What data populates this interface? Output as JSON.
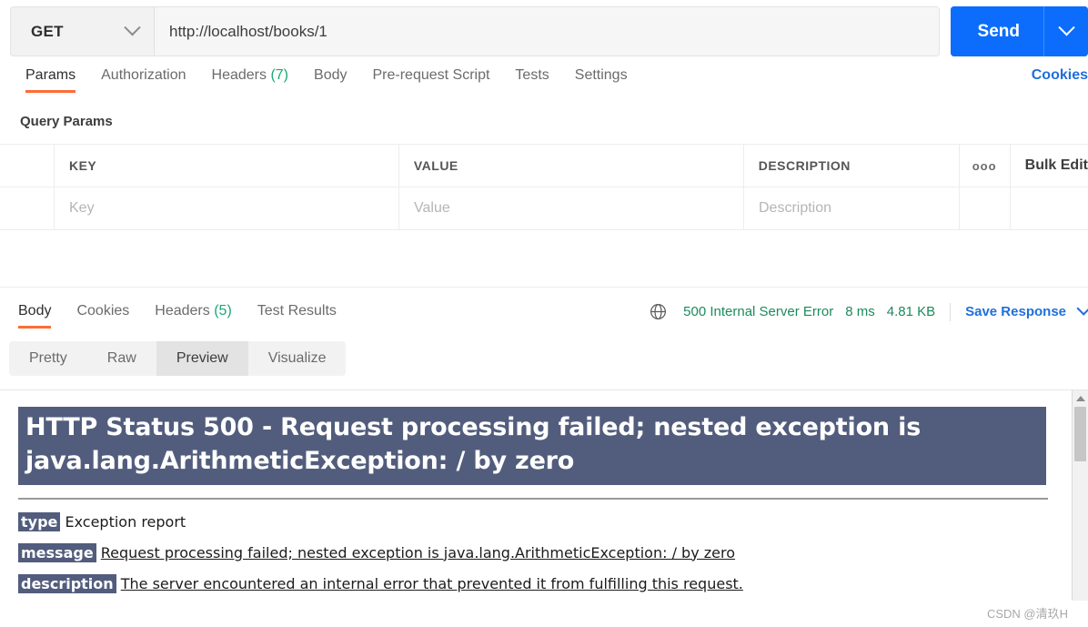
{
  "request": {
    "method": "GET",
    "url": "http://localhost/books/1",
    "send_label": "Send",
    "method_caret_icon": "chevron-down-icon",
    "send_caret_icon": "chevron-down-icon",
    "tabs": [
      {
        "label": "Params",
        "active": true,
        "count": null
      },
      {
        "label": "Authorization",
        "active": false,
        "count": null
      },
      {
        "label": "Headers",
        "active": false,
        "count": "(7)"
      },
      {
        "label": "Body",
        "active": false,
        "count": null
      },
      {
        "label": "Pre-request Script",
        "active": false,
        "count": null
      },
      {
        "label": "Tests",
        "active": false,
        "count": null
      },
      {
        "label": "Settings",
        "active": false,
        "count": null
      }
    ],
    "cookies_link": "Cookies"
  },
  "query_params": {
    "section_title": "Query Params",
    "headers": {
      "key": "KEY",
      "value": "VALUE",
      "description": "DESCRIPTION"
    },
    "options_icon": "ooo",
    "bulk_edit_label": "Bulk Edit",
    "placeholders": {
      "key": "Key",
      "value": "Value",
      "description": "Description"
    }
  },
  "response": {
    "tabs": [
      {
        "label": "Body",
        "active": true,
        "count": null
      },
      {
        "label": "Cookies",
        "active": false,
        "count": null
      },
      {
        "label": "Headers",
        "active": false,
        "count": "(5)"
      },
      {
        "label": "Test Results",
        "active": false,
        "count": null
      }
    ],
    "globe_icon": "globe-icon",
    "status": "500 Internal Server Error",
    "time": "8 ms",
    "size": "4.81 KB",
    "save_response_label": "Save Response",
    "save_caret_icon": "chevron-down-icon",
    "view_modes": [
      {
        "label": "Pretty",
        "active": false
      },
      {
        "label": "Raw",
        "active": false
      },
      {
        "label": "Preview",
        "active": true
      },
      {
        "label": "Visualize",
        "active": false
      }
    ]
  },
  "preview": {
    "banner": "HTTP Status 500 - Request processing failed; nested exception is java.lang.ArithmeticException: / by zero",
    "rows": [
      {
        "tag": "type",
        "text": "Exception report",
        "underlined": false
      },
      {
        "tag": "message",
        "text": "Request processing failed; nested exception is java.lang.ArithmeticException: / by zero",
        "underlined": true
      },
      {
        "tag": "description",
        "text": "The server encountered an internal error that prevented it from fulfilling this request.",
        "underlined": true
      }
    ],
    "scroll_up_icon": "triangle-up-icon"
  },
  "watermark": "CSDN @清玖H"
}
